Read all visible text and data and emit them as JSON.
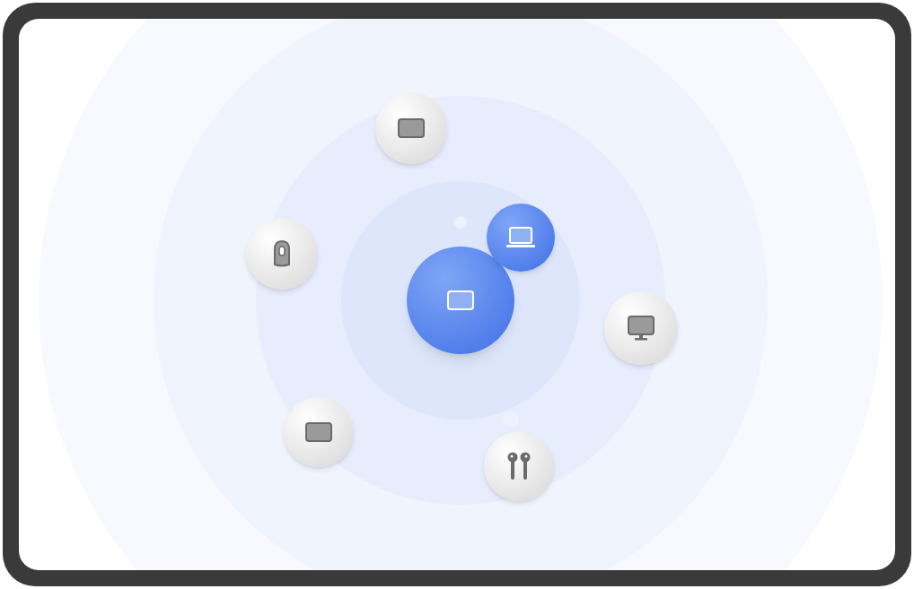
{
  "center": {
    "kind": "tablet"
  },
  "devices": [
    {
      "kind": "tablet",
      "connected": false
    },
    {
      "kind": "speaker",
      "connected": false
    },
    {
      "kind": "laptop",
      "connected": true
    },
    {
      "kind": "monitor",
      "connected": false
    },
    {
      "kind": "tablet",
      "connected": false
    },
    {
      "kind": "earbuds",
      "connected": false
    }
  ]
}
